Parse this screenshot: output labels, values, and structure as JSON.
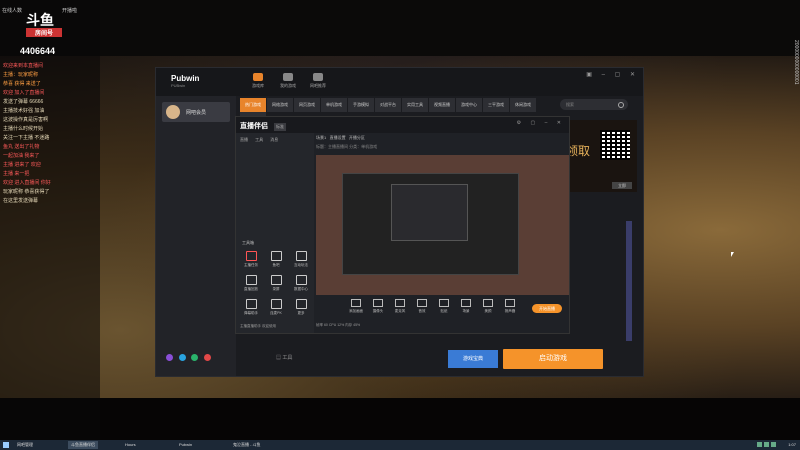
{
  "overlay": {
    "logo_main": "斗鱼",
    "logo_sub": "房间号",
    "follow_count": "4406644",
    "top_left_label": "在线人数",
    "top_right_label": "开播啦",
    "chat_lines": [
      {
        "text": "欢迎来到本直播间",
        "style": "r"
      },
      {
        "text": "主播：玩家昵称",
        "style": "u"
      },
      {
        "text": "恭喜 获得 来送了",
        "style": "u"
      },
      {
        "text": "欢迎 加入了直播间",
        "style": "r"
      },
      {
        "text": "",
        "style": ""
      },
      {
        "text": "发送了弹幕 66666",
        "style": ""
      },
      {
        "text": "主播技术好强 加油",
        "style": ""
      },
      {
        "text": "这波操作真是厉害啊",
        "style": ""
      },
      {
        "text": "主播什么时候开始",
        "style": ""
      },
      {
        "text": "关注一下主播 不迷路",
        "style": ""
      },
      {
        "text": "鱼丸 送出了礼物",
        "style": "r"
      },
      {
        "text": "一起加油 我来了",
        "style": "r"
      },
      {
        "text": "主播 进来了 欢迎",
        "style": "r"
      },
      {
        "text": "主播 来一把",
        "style": "r"
      },
      {
        "text": "欢迎 进入直播间 你好",
        "style": "r"
      },
      {
        "text": "",
        "style": ""
      },
      {
        "text": "玩家昵称 恭喜获得了",
        "style": ""
      },
      {
        "text": "在这里发送弹幕 ",
        "style": ""
      }
    ],
    "right_vertical": "2000000000000001"
  },
  "pubwin": {
    "brand": "Pubwin",
    "brand_sub": "PUBwin",
    "top_icons": [
      "游戏库",
      "我的游戏",
      "网吧推荐"
    ],
    "window_controls": "▣ – ▢ ✕",
    "user_name": "网吧会员",
    "nav": [
      "热门游戏",
      "网络游戏",
      "网页游戏",
      "单机游戏",
      "手游模拟",
      "对战平台",
      "实用工具",
      "视频直播",
      "游戏中心",
      "三平游戏",
      "休闲游戏",
      "本地游戏"
    ],
    "search_placeholder": "搜索",
    "banner_text": "领取",
    "banner_button": "立即",
    "tools_label": "工具",
    "btn_secondary": "游戏宝典",
    "btn_primary": "启动游戏"
  },
  "douyu_tool": {
    "logo": "直播伴侣",
    "tag": "标准",
    "left_tabs": [
      "直播",
      "工具",
      "消息"
    ],
    "tools_title": "工具箱",
    "tools": [
      "主播任务",
      "鱼吧",
      "互动玩法",
      "直播回放",
      "录屏",
      "数据中心",
      "弹幕助手",
      "连麦PK",
      "更多"
    ],
    "header_tabs": [
      "场景1",
      "直播设置",
      "开播分区"
    ],
    "header_info": "标题：主播直播间  分类：单机游戏",
    "controls": [
      "添加画面",
      "摄像头",
      "麦克风",
      "音效",
      "贴纸",
      "场景",
      "美颜",
      "扬声器"
    ],
    "live_button": "开始直播",
    "tip": "主播直播助手 欢迎使用",
    "status": "帧率 60  CPU 12%  内存 45%"
  },
  "taskbar": {
    "items": [
      "网吧管理",
      "斗鱼直播伴侣",
      "Hours",
      "Pubwin",
      "鬼泣直播 - 斗鱼"
    ],
    "active_index": 1,
    "clock": "1:07"
  }
}
